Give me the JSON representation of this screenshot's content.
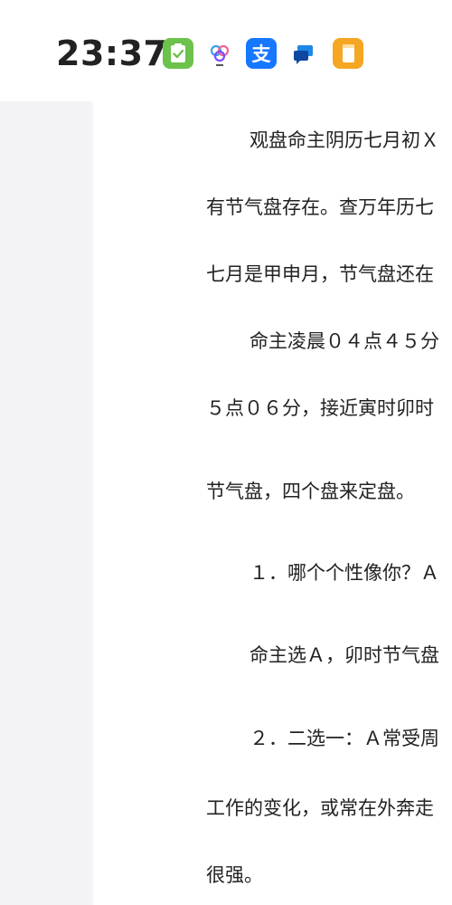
{
  "status_bar": {
    "time": "23:37",
    "icons": [
      "green-check-app-icon",
      "colorful-flower-app-icon",
      "alipay-icon",
      "message-bubble-app-icon",
      "yellow-note-app-icon"
    ]
  },
  "article": {
    "lines": [
      "观盘命主阴历七月初Ｘ",
      "有节气盘存在。查万年历七",
      "七月是甲申月，节气盘还在",
      "命主凌晨０４点４５分",
      "５点０６分，接近寅时卯时",
      "节气盘，四个盘来定盘。",
      "１．哪个个性像你？Ａ",
      "命主选Ａ，卯时节气盘",
      "２．二选一：Ａ常受周",
      "工作的变化，或常在外奔走",
      "很强。"
    ]
  }
}
